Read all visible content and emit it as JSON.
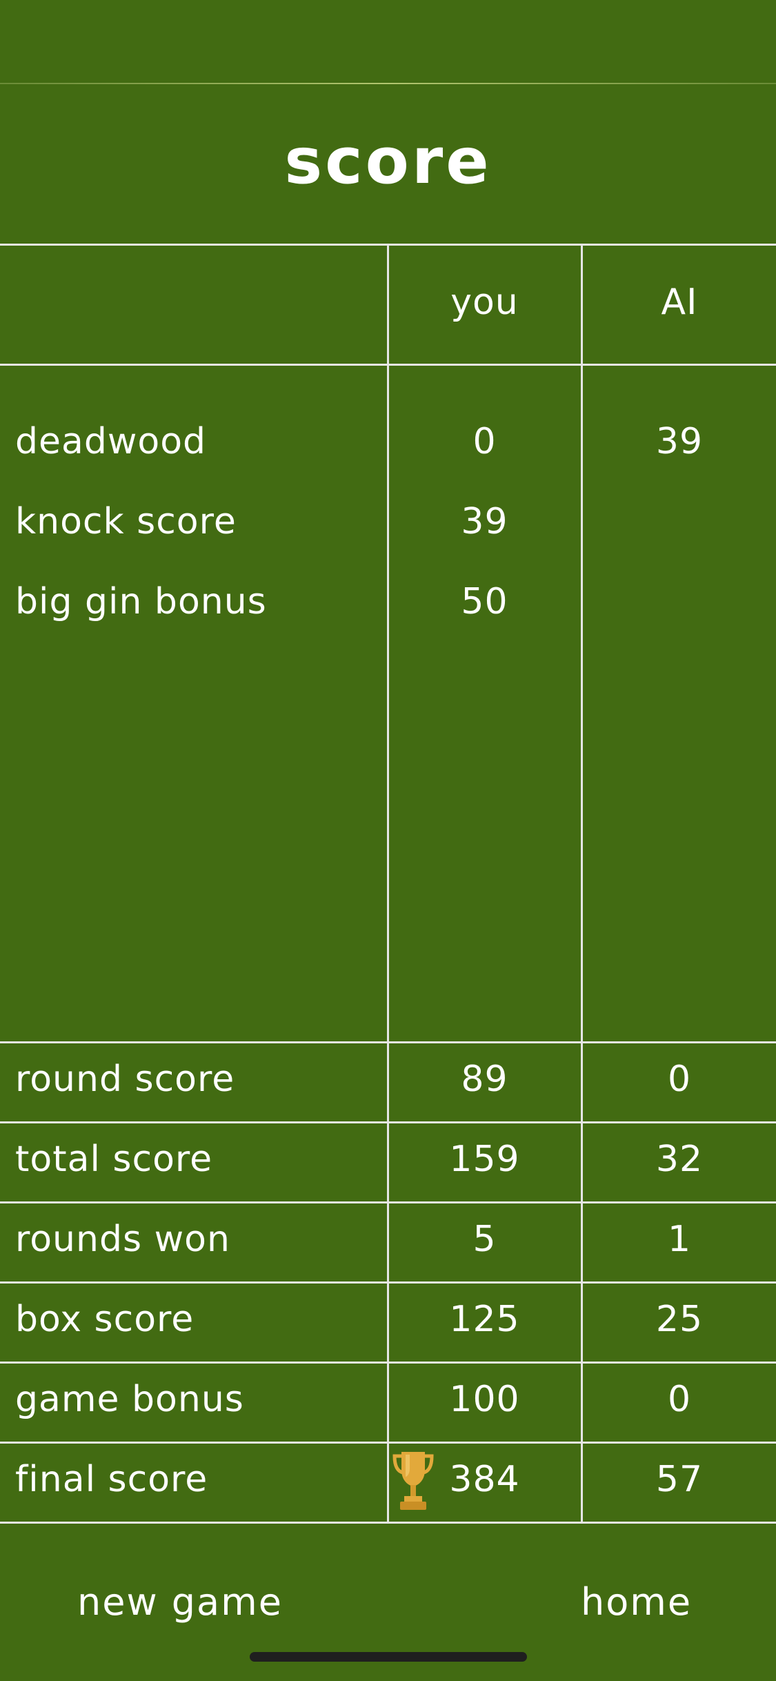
{
  "title": "score",
  "columns": {
    "you": "you",
    "ai": "AI"
  },
  "round_rows": [
    {
      "label": "deadwood",
      "you": "0",
      "ai": "39"
    },
    {
      "label": "knock score",
      "you": "39",
      "ai": ""
    },
    {
      "label": "big gin bonus",
      "you": "50",
      "ai": ""
    }
  ],
  "summary_rows": [
    {
      "label": "round score",
      "you": "89",
      "ai": "0"
    },
    {
      "label": "total score",
      "you": "159",
      "ai": "32"
    },
    {
      "label": "rounds won",
      "you": "5",
      "ai": "1"
    },
    {
      "label": "box score",
      "you": "125",
      "ai": "25"
    },
    {
      "label": "game bonus",
      "you": "100",
      "ai": "0"
    },
    {
      "label": "final score",
      "you": "384",
      "ai": "57"
    }
  ],
  "buttons": {
    "new_game": "new game",
    "home": "home"
  },
  "winner_icon": "trophy-icon",
  "colors": {
    "background": "#426b12",
    "grid": "#e6e6e6",
    "trophy": "#e2a93b"
  }
}
